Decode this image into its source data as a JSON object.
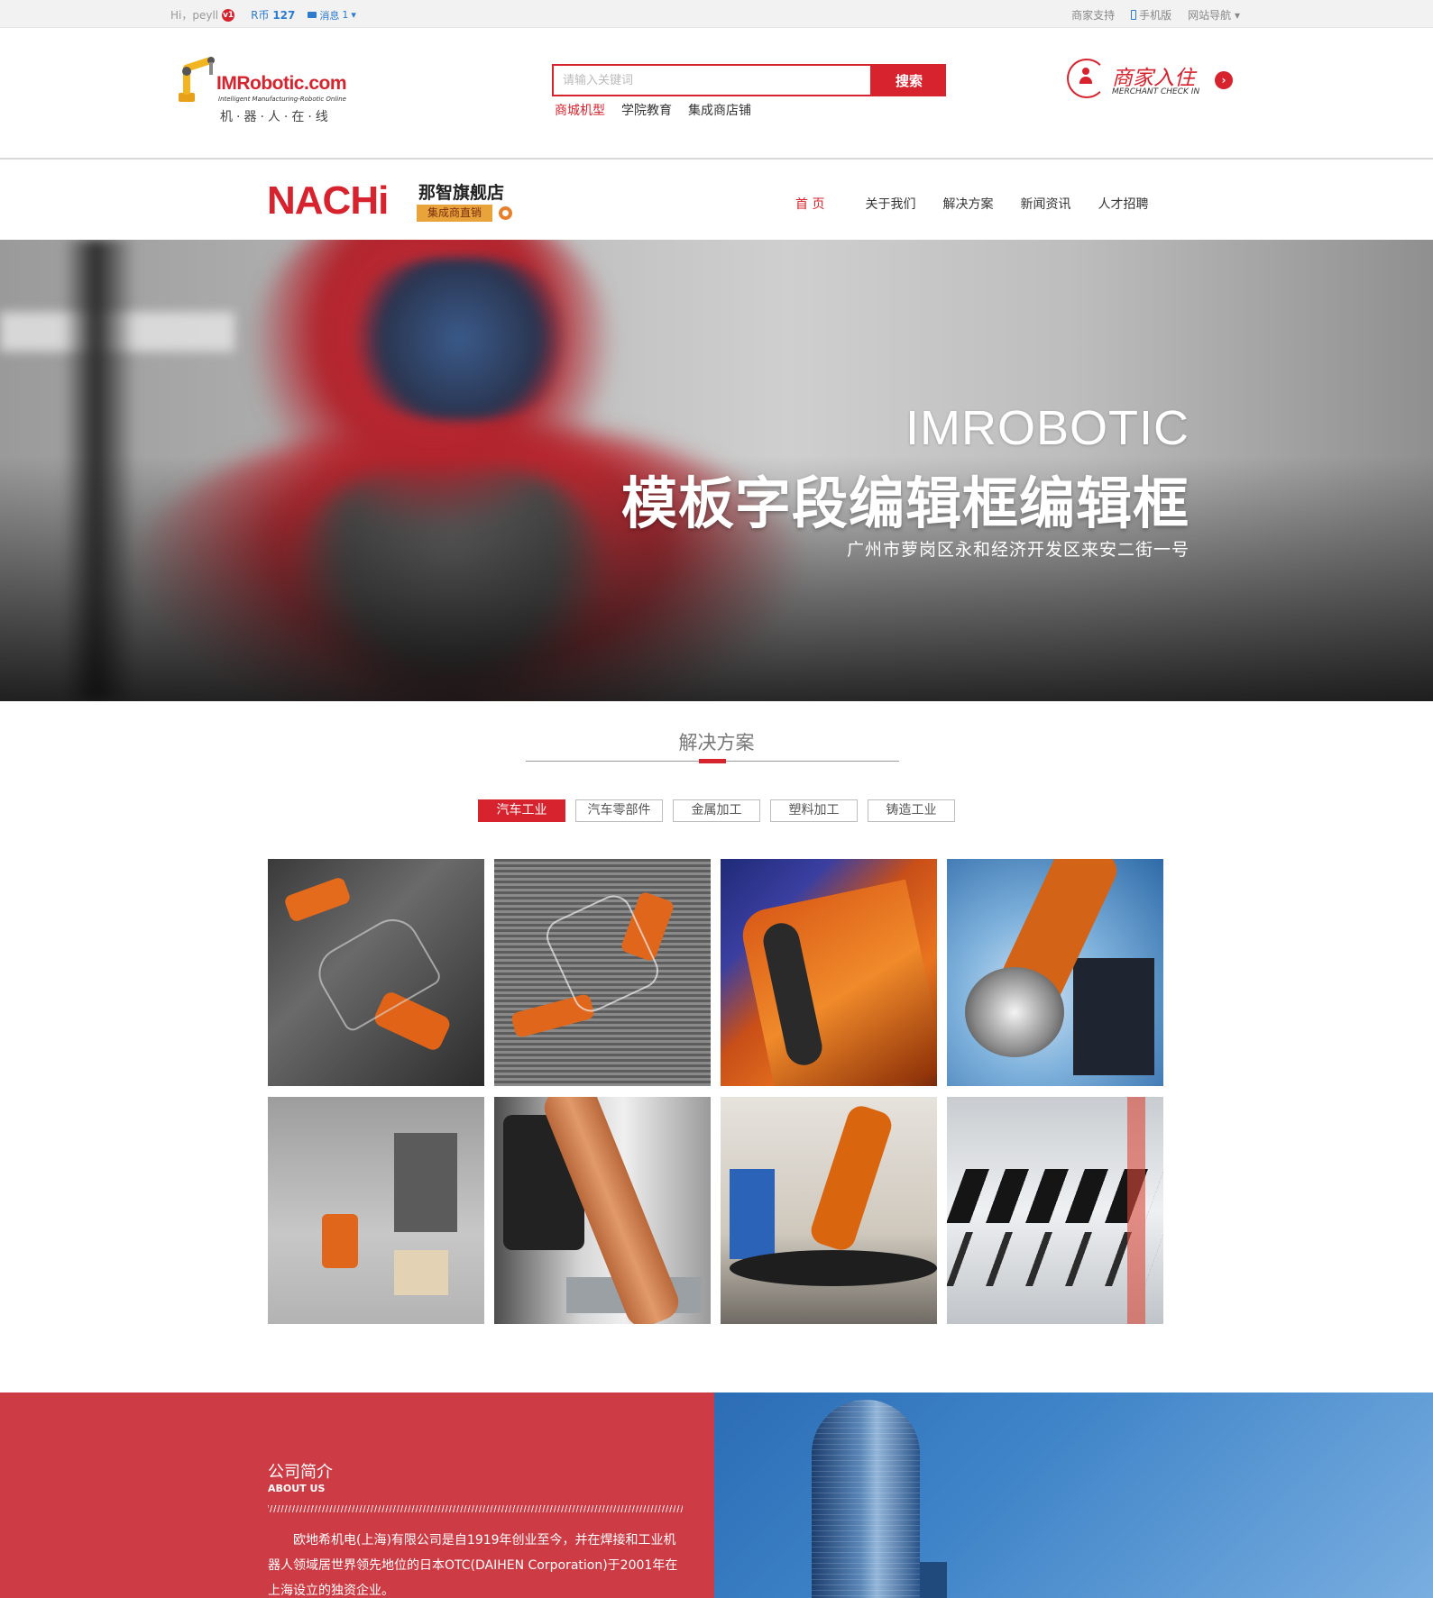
{
  "topbar": {
    "greeting": "Hi，peyll",
    "vip_badge": "v1",
    "coin_label": "R币",
    "coin_value": "127",
    "message_label": "消息",
    "message_count": "1",
    "links": [
      "商家支持",
      "手机版",
      "网站导航"
    ]
  },
  "header": {
    "logo": {
      "brand": "IMRobotic.com",
      "tagline": "Intelligent Manufacturing-Robotic Online",
      "cn": "机·器·人·在·线"
    },
    "search": {
      "placeholder": "请输入关键词",
      "button": "搜索"
    },
    "hot_links": [
      "商城机型",
      "学院教育",
      "集成商店铺"
    ],
    "merchant": {
      "title": "商家入住",
      "subtitle": "MERCHANT CHECK IN"
    }
  },
  "store": {
    "brand": "NACHi",
    "name": "那智旗舰店",
    "tag": "集成商直销",
    "nav": [
      "首 页",
      "关于我们",
      "解决方案",
      "新闻资讯",
      "人才招聘"
    ]
  },
  "hero": {
    "title_en": "IMROBOTIC",
    "title_cn": "模板字段编辑框编辑框",
    "address": "广州市萝岗区永和经济开发区来安二街一号"
  },
  "solutions": {
    "title": "解决方案",
    "tabs": [
      "汽车工业",
      "汽车零部件",
      "金属加工",
      "塑料加工",
      "铸造工业"
    ],
    "active_tab": "汽车工业",
    "images": [
      "conveyor-robots-image",
      "grid-floor-robots-image",
      "abb-robot-image",
      "robot-arm-image",
      "factory-floor-image",
      "paint-booth-robot-image",
      "lab-robot-image",
      "gripper-row-image"
    ]
  },
  "about": {
    "title": "公司简介",
    "subtitle": "ABOUT US",
    "text": "欧地希机电(上海)有限公司是自1919年创业至今，并在焊接和工业机器人领域居世界领先地位的日本OTC(DAIHEN Corporation)于2001年在上海设立的独资企业。"
  },
  "colors": {
    "accent": "#d6232e",
    "about_bg": "#cd3b44",
    "link_blue": "#2b7bd0"
  }
}
